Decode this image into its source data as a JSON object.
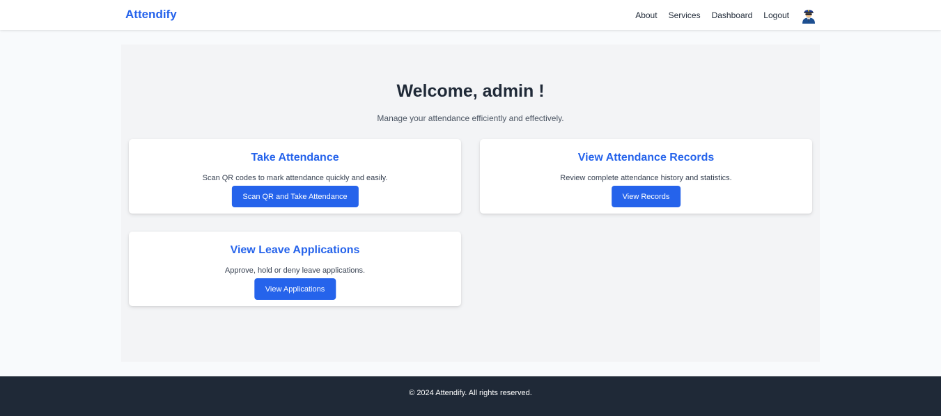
{
  "navbar": {
    "brand": "Attendify",
    "links": [
      "About",
      "Services",
      "Dashboard",
      "Logout"
    ],
    "avatar_icon": "police-officer-avatar-icon"
  },
  "main": {
    "welcome": "Welcome, admin !",
    "subtitle": "Manage your attendance efficiently and effectively.",
    "cards": [
      {
        "title": "Take Attendance",
        "description": "Scan QR codes to mark attendance quickly and easily.",
        "button": "Scan QR and Take Attendance"
      },
      {
        "title": "View Attendance Records",
        "description": "Review complete attendance history and statistics.",
        "button": "View Records"
      },
      {
        "title": "View Leave Applications",
        "description": "Approve, hold or deny leave applications.",
        "button": "View Applications"
      }
    ]
  },
  "footer": {
    "text": "© 2024 Attendify. All rights reserved."
  },
  "colors": {
    "accent": "#2563eb",
    "footer_bg": "#1f2937",
    "page_bg": "#f8fafc",
    "panel_bg": "#f3f4f6"
  }
}
